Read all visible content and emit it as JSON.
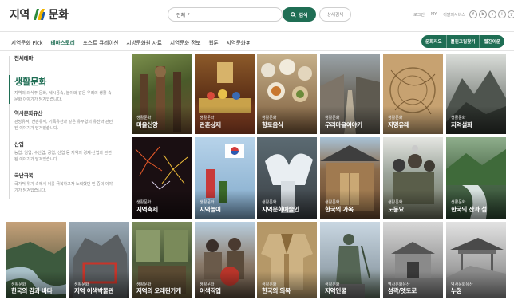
{
  "header": {
    "logo": {
      "text_left": "지역",
      "text_right": "문화"
    },
    "search": {
      "scope": "전체",
      "button": "검색",
      "advanced": "상세검색"
    },
    "util": [
      "로그인",
      "MY",
      "이달의서비스"
    ],
    "sns": [
      "f",
      "b",
      "t",
      "i",
      "y"
    ]
  },
  "nav": {
    "items": [
      "지역문화 Pick",
      "테마스토리",
      "포스트 큐레이션",
      "지방문화원 자료",
      "지역문화 정보",
      "웹툰",
      "지역문화#"
    ],
    "active_index": 1,
    "right": [
      "문화지도",
      "틀린그림찾기",
      "웹진이운"
    ]
  },
  "sidebar": {
    "header": "전체테마",
    "sections": [
      {
        "title": "생활문화",
        "desc": "지역의 의식주 문화, 세시풍속, 놀이와 같은 우리의 생활 속 문화 이야기가 담겨있습니다."
      },
      {
        "title": "역사문화유산",
        "desc": "관방유적, 산촌유적, 기록유산과 같은 유무형의 유산과 관련된 이야기가 담겨있습니다."
      },
      {
        "title": "산업",
        "desc": "농업, 임업, 수산업, 공업, 산업 등 지역의 경제·산업과 관련된 이야기가 담겨있습니다."
      },
      {
        "title": "국난극복",
        "desc": "국가적 위기 속에서 이를 극복하고자 노력했던 민·중의 이야기가 담겨있습니다."
      }
    ]
  },
  "tiles": [
    {
      "cat": "생활문화",
      "title": "마을신앙"
    },
    {
      "cat": "생활문화",
      "title": "관혼상제"
    },
    {
      "cat": "생활문화",
      "title": "향토음식"
    },
    {
      "cat": "생활문화",
      "title": "우리마을이야기"
    },
    {
      "cat": "생활문화",
      "title": "지명유래"
    },
    {
      "cat": "생활문화",
      "title": "지역설화"
    },
    {
      "cat": "생활문화",
      "title": "지역축제"
    },
    {
      "cat": "생활문화",
      "title": "지역놀이"
    },
    {
      "cat": "생활문화",
      "title": "지역문화예술인"
    },
    {
      "cat": "생활문화",
      "title": "한국의 가옥"
    },
    {
      "cat": "생활문화",
      "title": "노동요"
    },
    {
      "cat": "생활문화",
      "title": "한국의 산과 섬"
    },
    {
      "cat": "생활문화",
      "title": "한국의 강과 바다"
    },
    {
      "cat": "생활문화",
      "title": "지역 이색박물관"
    },
    {
      "cat": "생활문화",
      "title": "지역의 오래된가게"
    },
    {
      "cat": "생활문화",
      "title": "이색직업"
    },
    {
      "cat": "생활문화",
      "title": "한국의 의복"
    },
    {
      "cat": "생활문화",
      "title": "지역인물"
    },
    {
      "cat": "역사문화유산",
      "title": "성곽/옛도로"
    },
    {
      "cat": "역사문화유산",
      "title": "누정"
    }
  ]
}
